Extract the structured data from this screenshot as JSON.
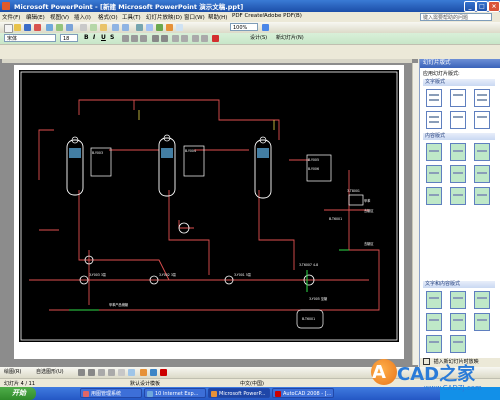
{
  "window": {
    "title": "Microsoft PowerPoint - [新建 Microsoft PowerPoint 演示文稿.ppt]",
    "min": "_",
    "max": "□",
    "close": "×"
  },
  "menu": {
    "items": [
      "文件(F)",
      "编辑(E)",
      "视图(V)",
      "插入(I)",
      "格式(O)",
      "工具(T)",
      "幻灯片放映(D)",
      "窗口(W)",
      "帮助(H)",
      "PDF Create!",
      "Adobe PDF(B)"
    ],
    "help_placeholder": "键入需要帮助的问题"
  },
  "toolbar1": {
    "zoom": "100%"
  },
  "toolbar2": {
    "font": "宋体",
    "size": "18",
    "bold": "B",
    "italic": "I",
    "underline": "U",
    "shadow": "S",
    "design": "设计(S)",
    "new_slide": "新幻灯片(N)"
  },
  "cad": {
    "towers": [
      {
        "label": "3-Y003\n甲苯塔"
      },
      {
        "label": "1-Y002\n分离塔"
      },
      {
        "label": "3-Y005\n分离塔"
      }
    ],
    "box_labels": [
      "B-Y003",
      "B-Y004",
      "B-Y005",
      "B-Y006"
    ],
    "text_items": [
      "3-T8001",
      "甲苯",
      "去罐区",
      "3-Y003 3泵",
      "3-Y002 3泵",
      "3-Y001 5泵",
      "B-T6001",
      "去罐区",
      "3-T6007 4-8",
      "B-T6001",
      "3-Y005 至罐",
      "甲苯产品储罐"
    ]
  },
  "taskpane": {
    "title": "幻灯片版式",
    "apply_label": "应用幻灯片版式:",
    "sections": [
      "文字版式",
      "内容版式",
      "文字和内容版式"
    ],
    "footer": "插入新幻灯片时放映"
  },
  "drawing_toolbar": {
    "draw": "绘图(R)",
    "autoshapes": "自选图形(U)"
  },
  "status": {
    "slide": "幻灯片 4 / 11",
    "design": "默认设计模板",
    "lang": "中文(中国)"
  },
  "taskbar": {
    "start": "开始",
    "tasks": [
      "用图管理系统",
      "10 Internet Exp...",
      "Microsoft PowerP...",
      "AutoCAD 2008 - [..."
    ]
  },
  "watermark": {
    "logo": "A",
    "brand": "CAD之家",
    "url": "www.CADZJ.com"
  },
  "colors": {
    "title_bar": "#1c4ea8",
    "slide_bg": "#000000",
    "line_red": "#e05050",
    "line_white": "#ffffff",
    "line_green": "#2fdc4a",
    "line_yellow": "#e8d94a"
  }
}
